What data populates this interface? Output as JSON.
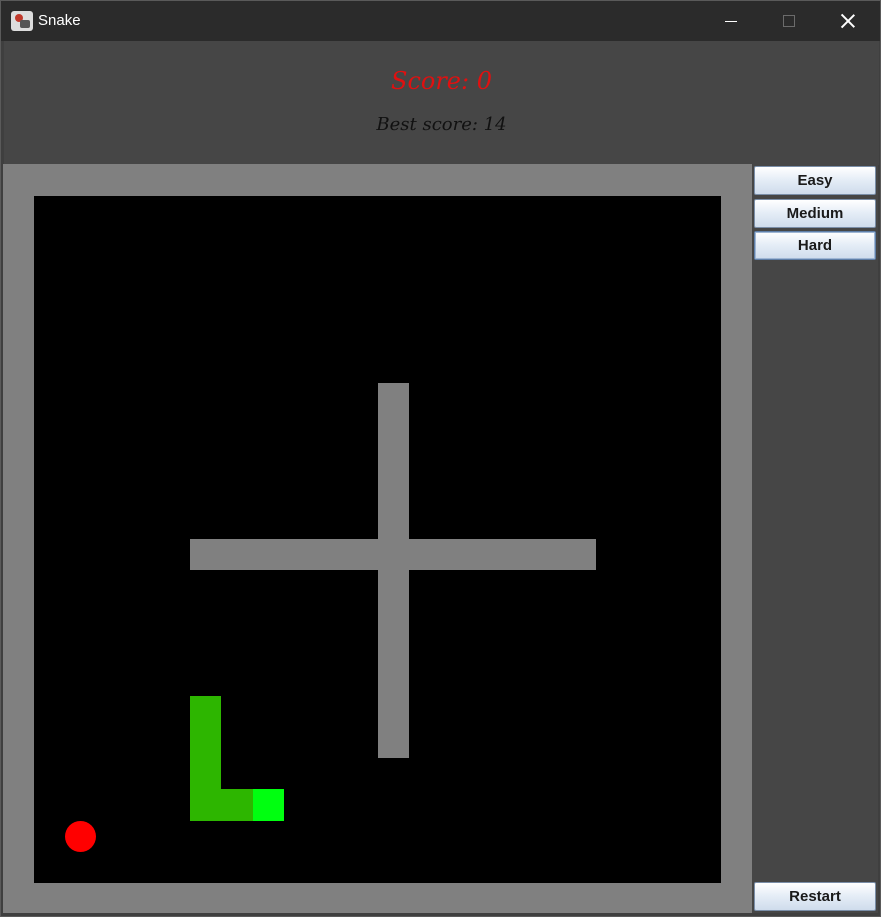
{
  "window": {
    "title": "Snake",
    "minimize_icon": "minimize-icon",
    "maximize_icon": "maximize-icon",
    "close_icon": "close-icon"
  },
  "header": {
    "score_label": "Score: 0",
    "best_score_label": "Best score: 14"
  },
  "difficulty_buttons": [
    "Easy",
    "Medium",
    "Hard"
  ],
  "restart_label": "Restart",
  "colors": {
    "score": "#e01010",
    "best_score": "#111111",
    "board_background": "#000000",
    "wall": "#808080",
    "snake_body": "#2db600",
    "snake_head": "#00ff10",
    "food": "#ff0000",
    "panel_background": "#464646"
  }
}
